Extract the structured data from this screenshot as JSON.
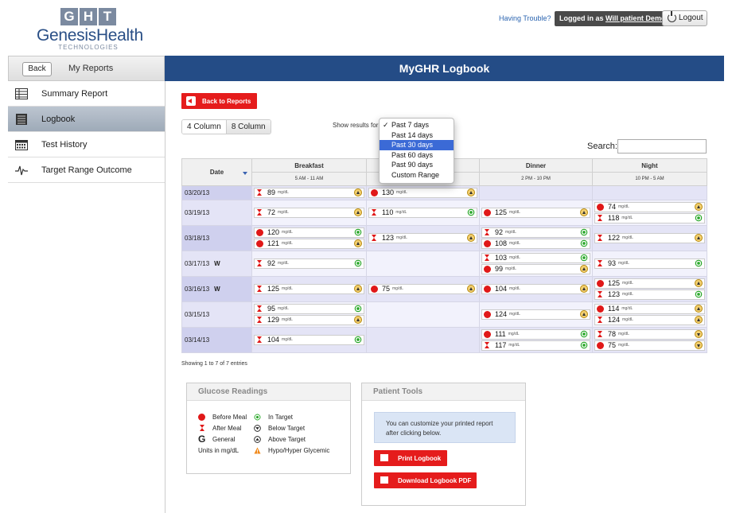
{
  "brand": {
    "letters": [
      "G",
      "H",
      "T"
    ],
    "name": "GenesisHealth",
    "sub": "TECHNOLOGIES"
  },
  "header": {
    "trouble": "Having Trouble?",
    "logged_prefix": "Logged in as ",
    "logged_user": "Will patient Demo",
    "logout": "Logout"
  },
  "sidebar": {
    "back": "Back",
    "my_reports": "My Reports",
    "items": [
      {
        "label": "Summary Report",
        "icon": "summary-icon"
      },
      {
        "label": "Logbook",
        "icon": "logbook-icon",
        "active": true
      },
      {
        "label": "Test History",
        "icon": "calendar-icon"
      },
      {
        "label": "Target Range Outcome",
        "icon": "pulse-icon"
      }
    ]
  },
  "page": {
    "title": "MyGHR Logbook",
    "back_reports": "Back to Reports",
    "col4": "4 Column",
    "col8": "8 Column",
    "show_results": "Show results for",
    "search": "Search:"
  },
  "dropdown": {
    "options": [
      "Past 7 days",
      "Past 14 days",
      "Past 30 days",
      "Past 60 days",
      "Past 90 days",
      "Custom Range"
    ],
    "checked": "Past 7 days",
    "highlighted": "Past 30 days"
  },
  "table": {
    "headers": {
      "date": "Date",
      "breakfast": "Breakfast",
      "breakfast_time": "5 AM - 11 AM",
      "lunch_time": "",
      "dinner": "Dinner",
      "dinner_time": "2 PM - 10 PM",
      "night": "Night",
      "night_time": "10 PM - 5 AM"
    },
    "unit": "mg/dL",
    "rows": [
      {
        "date": "03/20/13",
        "w": "",
        "breakfast": [
          {
            "v": "89",
            "m": "after",
            "s": "above"
          }
        ],
        "lunch": [
          {
            "v": "130",
            "m": "before",
            "s": "above"
          }
        ],
        "dinner": [],
        "night": []
      },
      {
        "date": "03/19/13",
        "w": "",
        "breakfast": [
          {
            "v": "72",
            "m": "after",
            "s": "above"
          }
        ],
        "lunch": [
          {
            "v": "110",
            "m": "after",
            "s": "target"
          }
        ],
        "dinner": [
          {
            "v": "125",
            "m": "before",
            "s": "above"
          }
        ],
        "night": [
          {
            "v": "74",
            "m": "before",
            "s": "above"
          },
          {
            "v": "118",
            "m": "after",
            "s": "target"
          }
        ]
      },
      {
        "date": "03/18/13",
        "w": "",
        "breakfast": [
          {
            "v": "120",
            "m": "before",
            "s": "target"
          },
          {
            "v": "121",
            "m": "before",
            "s": "above"
          }
        ],
        "lunch": [
          {
            "v": "123",
            "m": "after",
            "s": "above"
          }
        ],
        "dinner": [
          {
            "v": "92",
            "m": "after",
            "s": "target"
          },
          {
            "v": "108",
            "m": "before",
            "s": "target"
          }
        ],
        "night": [
          {
            "v": "122",
            "m": "after",
            "s": "above"
          }
        ]
      },
      {
        "date": "03/17/13",
        "w": "W",
        "breakfast": [
          {
            "v": "92",
            "m": "after",
            "s": "target"
          }
        ],
        "lunch": [],
        "dinner": [
          {
            "v": "103",
            "m": "after",
            "s": "target"
          },
          {
            "v": "99",
            "m": "before",
            "s": "above"
          }
        ],
        "night": [
          {
            "v": "93",
            "m": "after",
            "s": "target"
          }
        ]
      },
      {
        "date": "03/16/13",
        "w": "W",
        "breakfast": [
          {
            "v": "125",
            "m": "after",
            "s": "above"
          }
        ],
        "lunch": [
          {
            "v": "75",
            "m": "before",
            "s": "above"
          }
        ],
        "dinner": [
          {
            "v": "104",
            "m": "before",
            "s": "above"
          }
        ],
        "night": [
          {
            "v": "125",
            "m": "before",
            "s": "above"
          },
          {
            "v": "123",
            "m": "after",
            "s": "target"
          }
        ]
      },
      {
        "date": "03/15/13",
        "w": "",
        "breakfast": [
          {
            "v": "95",
            "m": "after",
            "s": "target"
          },
          {
            "v": "129",
            "m": "after",
            "s": "above"
          }
        ],
        "lunch": [],
        "dinner": [
          {
            "v": "124",
            "m": "before",
            "s": "above"
          }
        ],
        "night": [
          {
            "v": "114",
            "m": "before",
            "s": "above"
          },
          {
            "v": "124",
            "m": "after",
            "s": "above"
          }
        ]
      },
      {
        "date": "03/14/13",
        "w": "",
        "breakfast": [
          {
            "v": "104",
            "m": "after",
            "s": "target"
          }
        ],
        "lunch": [],
        "dinner": [
          {
            "v": "111",
            "m": "before",
            "s": "target"
          },
          {
            "v": "117",
            "m": "after",
            "s": "target"
          }
        ],
        "night": [
          {
            "v": "78",
            "m": "after",
            "s": "below"
          },
          {
            "v": "75",
            "m": "before",
            "s": "below"
          }
        ]
      }
    ]
  },
  "entries": "Showing 1 to 7 of 7 entries",
  "legend": {
    "title": "Glucose Readings",
    "before": "Before Meal",
    "after": "After Meal",
    "general_glyph": "G",
    "general": "General",
    "units": "Units in mg/dL",
    "in_target": "In Target",
    "below": "Below Target",
    "above": "Above Target",
    "hypo": "Hypo/Hyper Glycemic"
  },
  "tools": {
    "title": "Patient Tools",
    "note": "You can customize your printed report after clicking below.",
    "print": "Print Logbook",
    "pdf": "Download Logbook PDF"
  }
}
